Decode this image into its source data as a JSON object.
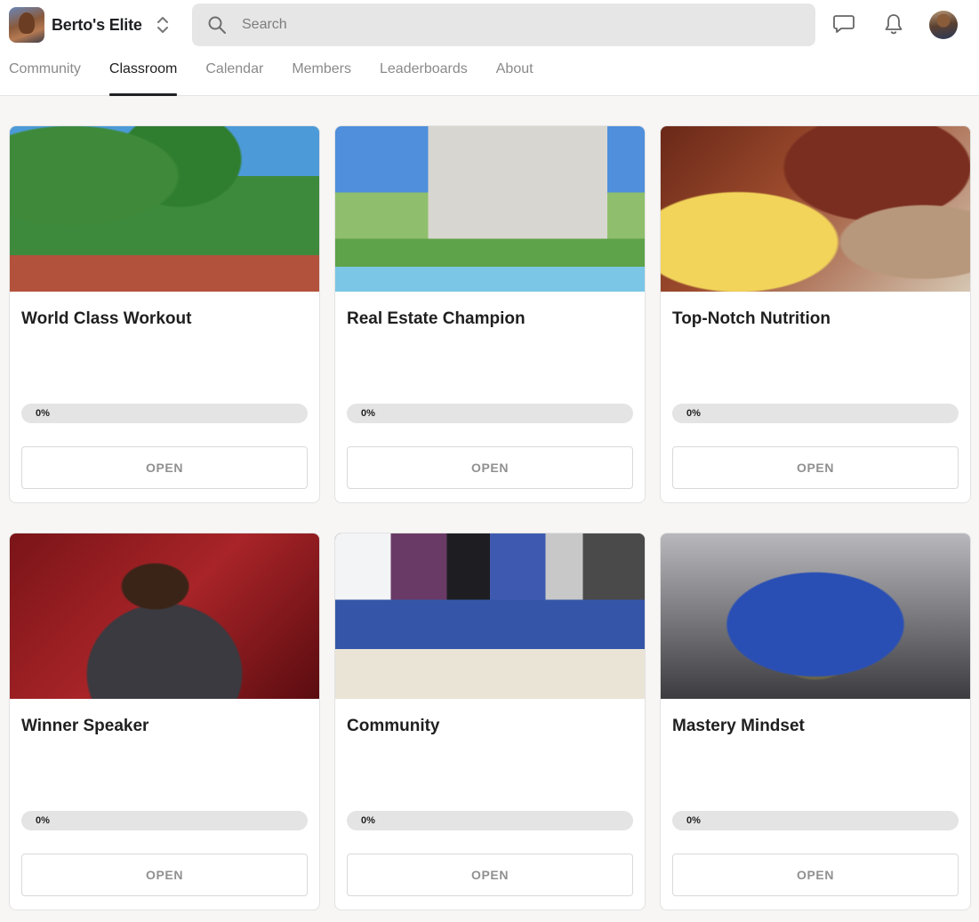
{
  "header": {
    "brand_name": "Berto's Elite",
    "search_placeholder": "Search",
    "icons": {
      "switcher": "chevron-up-down-icon",
      "search": "search-icon",
      "chat": "chat-icon",
      "notifications": "bell-icon"
    }
  },
  "tabs": [
    {
      "label": "Community",
      "active": false
    },
    {
      "label": "Classroom",
      "active": true
    },
    {
      "label": "Calendar",
      "active": false
    },
    {
      "label": "Members",
      "active": false
    },
    {
      "label": "Leaderboards",
      "active": false
    },
    {
      "label": "About",
      "active": false
    }
  ],
  "courses": [
    {
      "title": "World Class Workout",
      "progress_label": "0%",
      "progress": 0,
      "button": "OPEN"
    },
    {
      "title": "Real Estate Champion",
      "progress_label": "0%",
      "progress": 0,
      "button": "OPEN"
    },
    {
      "title": "Top-Notch Nutrition",
      "progress_label": "0%",
      "progress": 0,
      "button": "OPEN"
    },
    {
      "title": "Winner Speaker",
      "progress_label": "0%",
      "progress": 0,
      "button": "OPEN"
    },
    {
      "title": "Community",
      "progress_label": "0%",
      "progress": 0,
      "button": "OPEN"
    },
    {
      "title": "Mastery Mindset",
      "progress_label": "0%",
      "progress": 0,
      "button": "OPEN"
    }
  ],
  "colors": {
    "accent": "#202124",
    "background": "#f7f6f4",
    "progress_track": "#e4e4e4"
  }
}
